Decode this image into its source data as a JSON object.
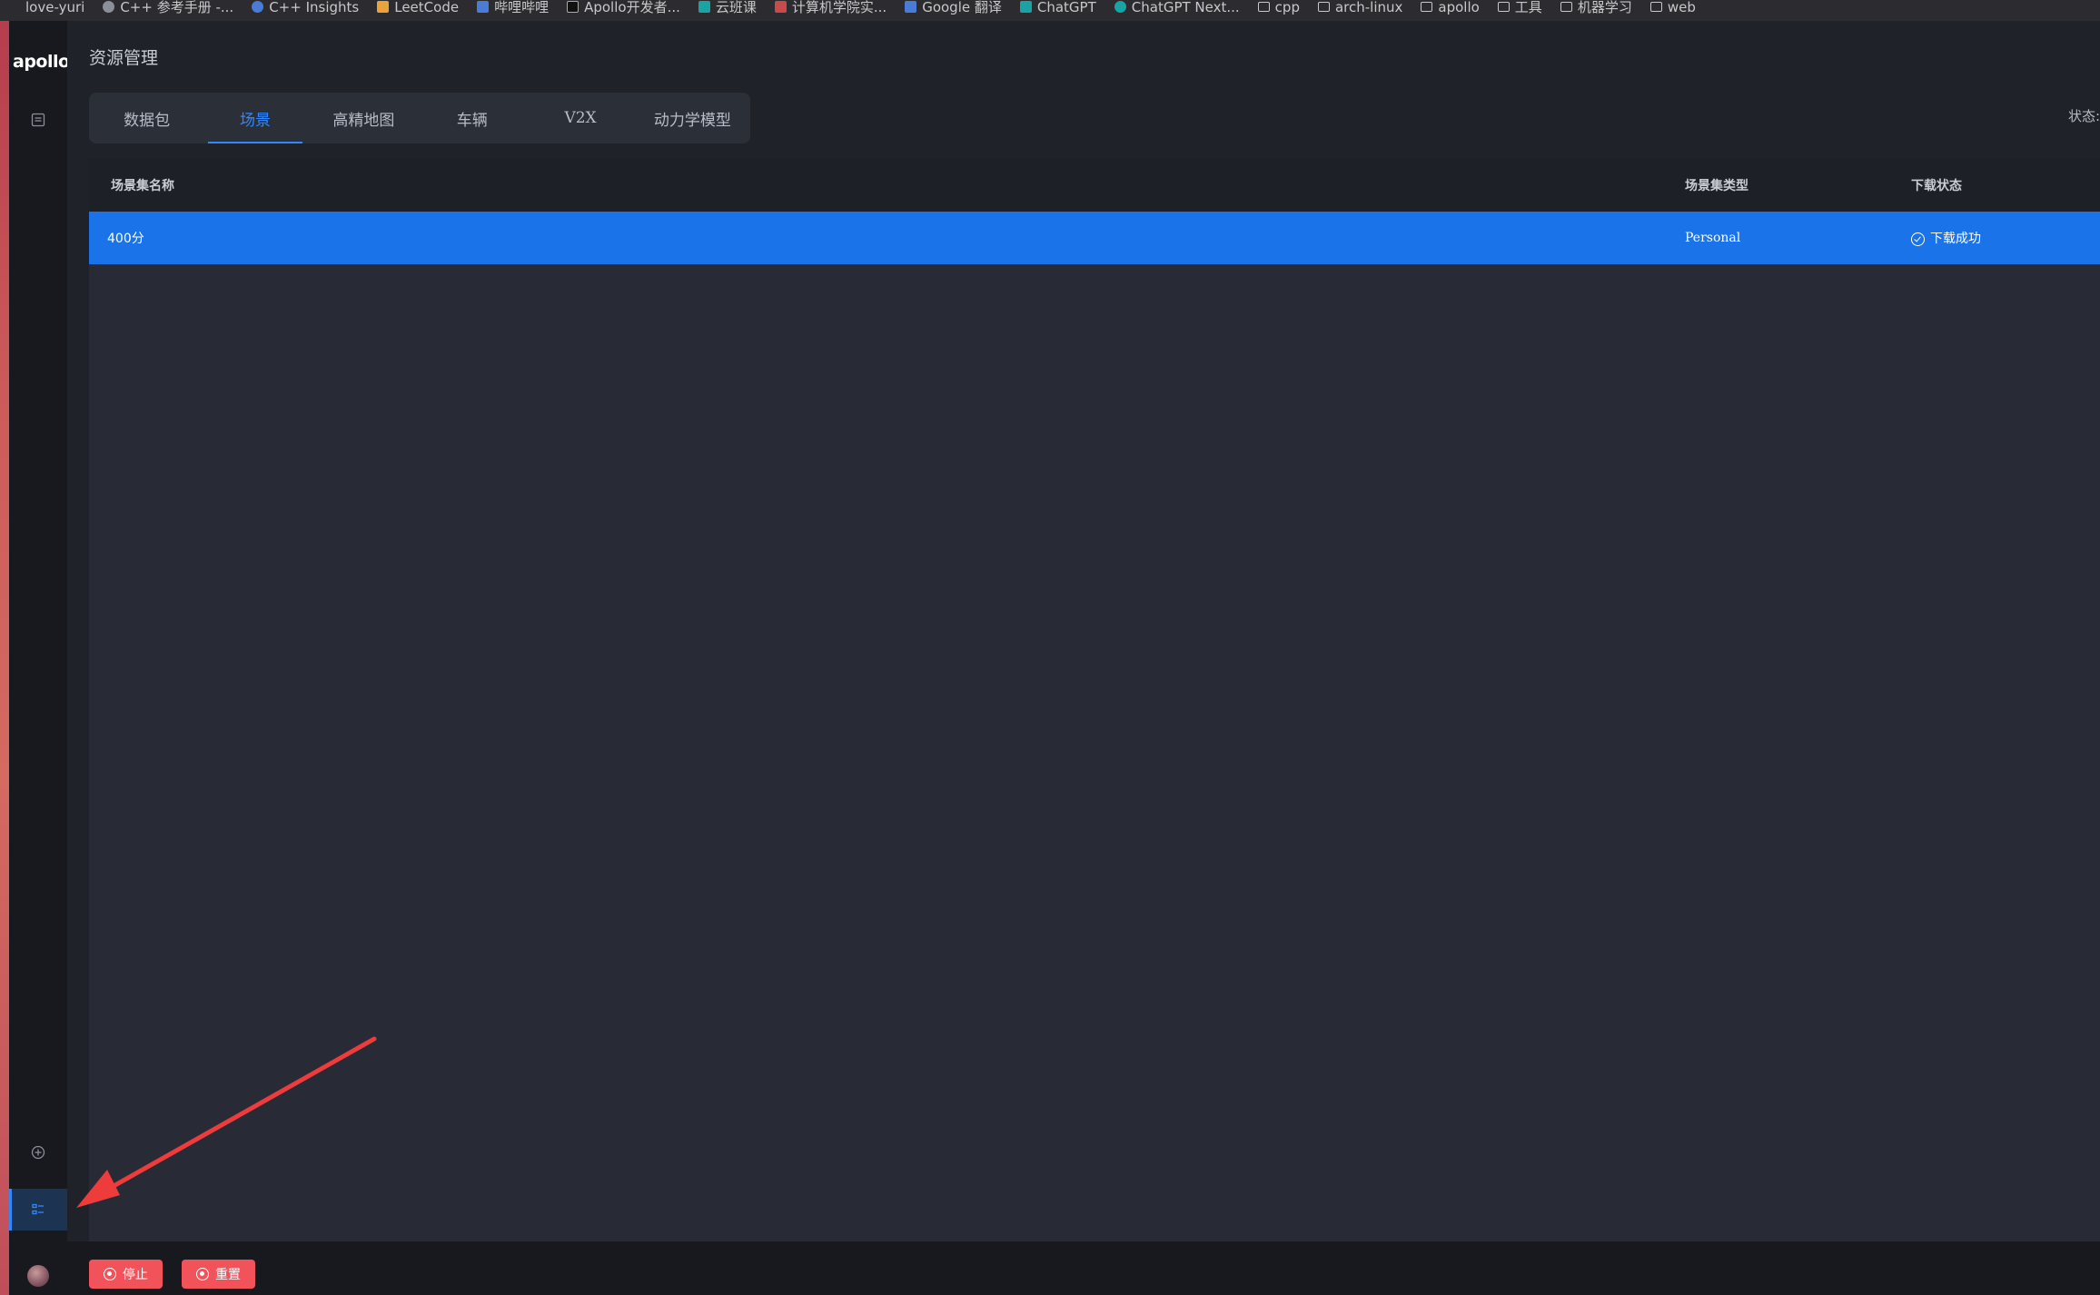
{
  "bookmarks": [
    {
      "label": "love-yuri",
      "icon": "folder"
    },
    {
      "label": "C++ 参考手册 -...",
      "icon": "cpp-icon"
    },
    {
      "label": "C++ Insights",
      "icon": "search-icon"
    },
    {
      "label": "LeetCode",
      "icon": "leetcode-icon"
    },
    {
      "label": "哔哩哔哩",
      "icon": "bilibili-icon"
    },
    {
      "label": "Apollo开发者...",
      "icon": "apollo-icon"
    },
    {
      "label": "云班课",
      "icon": "cloud-icon"
    },
    {
      "label": "计算机学院实...",
      "icon": "school-icon"
    },
    {
      "label": "Google 翻译",
      "icon": "translate-icon"
    },
    {
      "label": "ChatGPT",
      "icon": "chatgpt-icon"
    },
    {
      "label": "ChatGPT Next...",
      "icon": "chatgpt-next-icon"
    },
    {
      "label": "cpp",
      "icon": "folder"
    },
    {
      "label": "arch-linux",
      "icon": "folder"
    },
    {
      "label": "apollo",
      "icon": "folder"
    },
    {
      "label": "工具",
      "icon": "folder"
    },
    {
      "label": "机器学习",
      "icon": "folder"
    },
    {
      "label": "web",
      "icon": "folder"
    }
  ],
  "sidebar": {
    "logo": "apollo",
    "icons": [
      "list-icon",
      "add-circle-icon",
      "resource-manager-icon"
    ]
  },
  "header": {
    "title": "资源管理",
    "status_label": "状态:"
  },
  "tabs": [
    {
      "label": "数据包",
      "active": false
    },
    {
      "label": "场景",
      "active": true
    },
    {
      "label": "高精地图",
      "active": false
    },
    {
      "label": "车辆",
      "active": false
    },
    {
      "label": "V2X",
      "active": false
    },
    {
      "label": "动力学模型",
      "active": false
    }
  ],
  "table": {
    "columns": [
      "场景集名称",
      "场景集类型",
      "下载状态"
    ],
    "rows": [
      {
        "name": "400分",
        "type": "Personal",
        "status": "下载成功",
        "selected": true
      }
    ]
  },
  "bottom_bar": {
    "stop_label": "停止",
    "reset_label": "重置"
  },
  "colors": {
    "accent": "#3288fa",
    "row_selected": "#1a73e8",
    "danger": "#f2535b",
    "annotation_arrow": "#ee3b3b"
  }
}
